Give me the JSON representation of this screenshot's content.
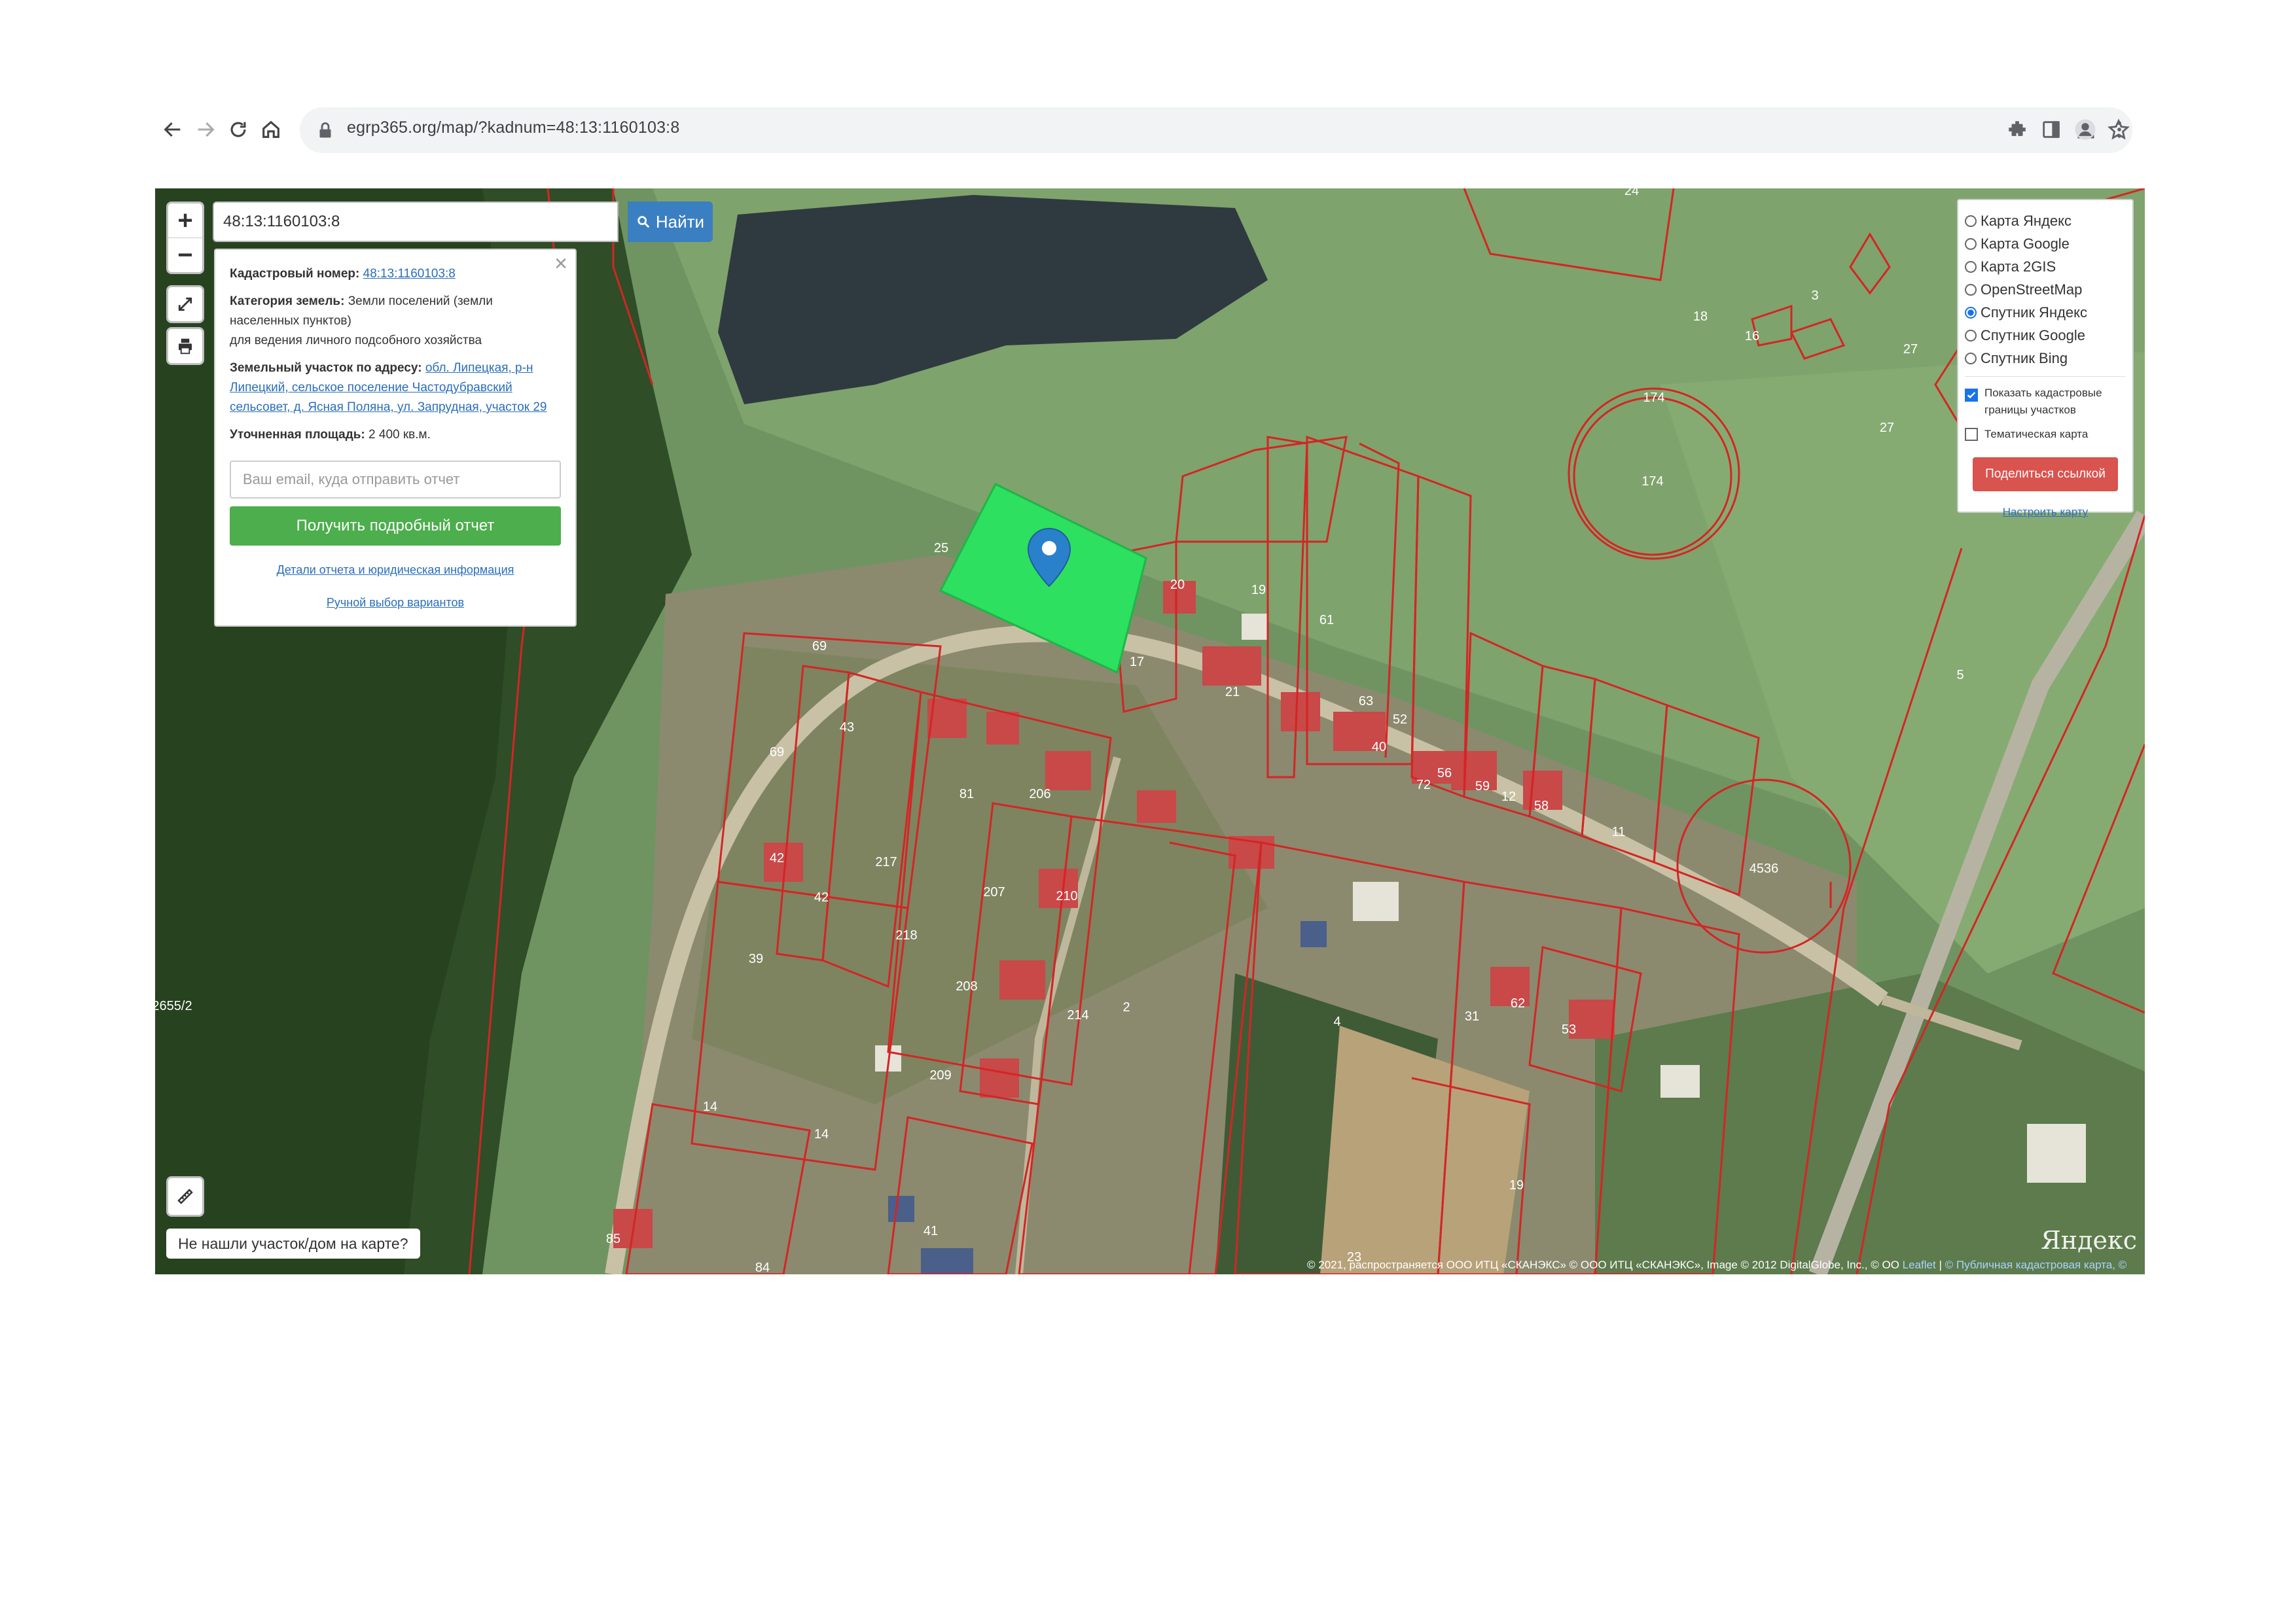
{
  "browser": {
    "url": "egrp365.org/map/?kadnum=48:13:1160103:8"
  },
  "search": {
    "value": "48:13:1160103:8",
    "button_label": "Найти"
  },
  "info": {
    "cadastral_label": "Кадастровый номер:",
    "cadastral_value": "48:13:1160103:8",
    "category_label": "Категория земель:",
    "category_value": "Земли поселений (земли населенных пунктов)",
    "category_use": "для ведения личного подсобного хозяйства",
    "address_label": "Земельный участок по адресу:",
    "address_value": "обл. Липецкая, р-н Липецкий, сельское поселение Частодубравский сельсовет, д. Ясная Поляна, ул. Запрудная, участок 29",
    "area_label": "Уточненная площадь:",
    "area_value": "2 400 кв.м.",
    "email_placeholder": "Ваш email, куда отправить отчет",
    "report_button": "Получить подробный отчет",
    "details_link": "Детали отчета и юридическая информация",
    "manual_link": "Ручной выбор вариантов"
  },
  "layers": {
    "options": [
      "Карта Яндекс",
      "Карта Google",
      "Карта 2GIS",
      "OpenStreetMap",
      "Спутник Яндекс",
      "Спутник Google",
      "Спутник Bing"
    ],
    "selected": "Спутник Яндекс",
    "show_boundaries": "Показать кадастровые границы участков",
    "show_boundaries_checked": true,
    "thematic": "Тематическая карта",
    "thematic_checked": false,
    "share_button": "Поделиться ссылкой",
    "setup_link": "Настроить карту"
  },
  "map_labels": [
    "24",
    "18",
    "16",
    "3",
    "27",
    "27",
    "174",
    "174",
    "5",
    "25",
    "20",
    "19",
    "61",
    "17",
    "21",
    "63",
    "52",
    "40",
    "72",
    "56",
    "59",
    "12",
    "58",
    "11",
    "4536",
    "69",
    "43",
    "69",
    "81",
    "206",
    "217",
    "218",
    "207",
    "210",
    "42",
    "42",
    "39",
    "208",
    "214",
    "2",
    "4",
    "53",
    "31",
    "62",
    "14",
    "14",
    "209",
    "19",
    "85",
    "41",
    "84",
    "23",
    "2655/2"
  ],
  "not_found_button": "Не нашли участок/дом на карте?",
  "attribution": {
    "text": "© 2021, распространяется ООО ИТЦ «СКАНЭКС» © ООО ИТЦ «СКАНЭКС», Image © 2012 DigitalGlobe, Inc., © OO",
    "leaflet": "Leaflet",
    "cadastral_map": "© Публичная кадастровая карта, ©"
  },
  "logo": "Яндекс",
  "colors": {
    "highlight_parcel": "#2de05f",
    "boundary": "#d42525",
    "search_button": "#3a7fc1",
    "report_button": "#4cae4c",
    "share_button": "#d9534f"
  }
}
